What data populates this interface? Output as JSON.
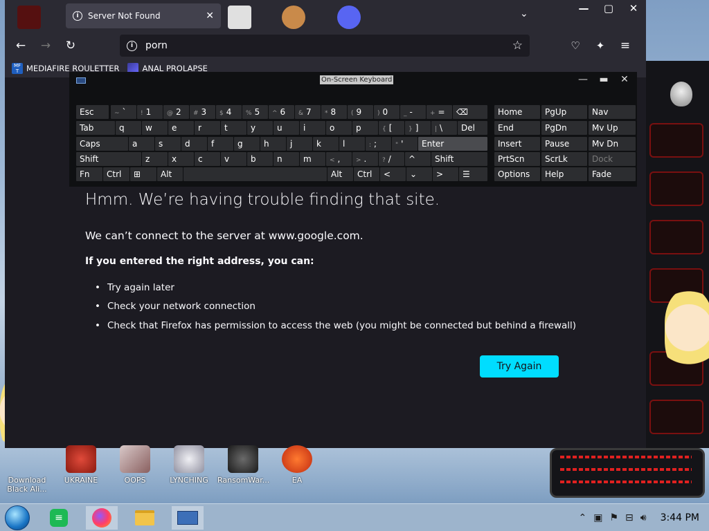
{
  "browser": {
    "tab_title": "Server Not Found",
    "tab_close": "✕",
    "url": "porn",
    "window_controls": [
      "—",
      "▢",
      "✕"
    ]
  },
  "bookmarks": [
    {
      "label": "MEDIAFIRE ROULETTER",
      "icon": "MF\nT"
    },
    {
      "label": "ANAL PROLAPSE",
      "icon": ""
    }
  ],
  "error": {
    "title": "Hmm. We’re having trouble finding that site.",
    "message": "We can’t connect to the server at www.google.com.",
    "subtitle": "If you entered the right address, you can:",
    "items": [
      "Try again later",
      "Check your network connection",
      "Check that Firefox has permission to access the web (you might be connected but behind a firewall)"
    ],
    "button": "Try Again"
  },
  "osk": {
    "title": "On-Screen Keyboard",
    "row1": [
      {
        "l": "Esc"
      },
      {
        "s": "~",
        "l": "`"
      },
      {
        "s": "!",
        "l": "1"
      },
      {
        "s": "@",
        "l": "2"
      },
      {
        "s": "#",
        "l": "3"
      },
      {
        "s": "$",
        "l": "4"
      },
      {
        "s": "%",
        "l": "5"
      },
      {
        "s": "^",
        "l": "6"
      },
      {
        "s": "&",
        "l": "7"
      },
      {
        "s": "*",
        "l": "8"
      },
      {
        "s": "(",
        "l": "9"
      },
      {
        "s": ")",
        "l": "0"
      },
      {
        "s": "_",
        "l": "-"
      },
      {
        "s": "+",
        "l": "="
      },
      {
        "l": "⌫"
      }
    ],
    "row2": [
      {
        "l": "Tab"
      },
      {
        "l": "q"
      },
      {
        "l": "w"
      },
      {
        "l": "e"
      },
      {
        "l": "r"
      },
      {
        "l": "t"
      },
      {
        "l": "y"
      },
      {
        "l": "u"
      },
      {
        "l": "i"
      },
      {
        "l": "o"
      },
      {
        "l": "p"
      },
      {
        "s": "{",
        "l": "["
      },
      {
        "s": "}",
        "l": "]"
      },
      {
        "s": "|",
        "l": "\\"
      },
      {
        "l": "Del"
      }
    ],
    "row3": [
      {
        "l": "Caps"
      },
      {
        "l": "a"
      },
      {
        "l": "s"
      },
      {
        "l": "d"
      },
      {
        "l": "f"
      },
      {
        "l": "g"
      },
      {
        "l": "h"
      },
      {
        "l": "j"
      },
      {
        "l": "k"
      },
      {
        "l": "l"
      },
      {
        "s": ":",
        "l": ";"
      },
      {
        "s": "\"",
        "l": "'"
      },
      {
        "l": "Enter"
      }
    ],
    "row4": [
      {
        "l": "Shift"
      },
      {
        "l": "z"
      },
      {
        "l": "x"
      },
      {
        "l": "c"
      },
      {
        "l": "v"
      },
      {
        "l": "b"
      },
      {
        "l": "n"
      },
      {
        "l": "m"
      },
      {
        "s": "<",
        "l": ","
      },
      {
        "s": ">",
        "l": "."
      },
      {
        "s": "?",
        "l": "/"
      },
      {
        "l": "^"
      },
      {
        "l": "Shift"
      }
    ],
    "row5": [
      {
        "l": "Fn"
      },
      {
        "l": "Ctrl"
      },
      {
        "l": "⊞"
      },
      {
        "l": "Alt"
      },
      {
        "l": ""
      },
      {
        "l": "Alt"
      },
      {
        "l": "Ctrl"
      },
      {
        "l": "<"
      },
      {
        "l": "⌄"
      },
      {
        "l": ">"
      },
      {
        "l": "☰"
      }
    ],
    "nav": [
      [
        "Home",
        "PgUp",
        "Nav"
      ],
      [
        "End",
        "PgDn",
        "Mv Up"
      ],
      [
        "Insert",
        "Pause",
        "Mv Dn"
      ],
      [
        "PrtScn",
        "ScrLk",
        "Dock"
      ],
      [
        "Options",
        "Help",
        "Fade"
      ]
    ]
  },
  "desktop_icons": [
    {
      "label": "Download Black Ali...",
      "color": "#c8d6e6"
    },
    {
      "label": "UKRAINE",
      "color": "#d43a2a"
    },
    {
      "label": "OOPS",
      "color": "#b8a8a8"
    },
    {
      "label": "LYNCHING",
      "color": "#c8c8d0"
    },
    {
      "label": "RansomWar...",
      "color": "#3a3a3a"
    },
    {
      "label": "EA",
      "color": "#e0501a"
    }
  ],
  "taskbar": {
    "apps": [
      "spotify-icon",
      "firefox-icon",
      "file-explorer-icon",
      "osk-icon"
    ],
    "clock": "3:44 PM"
  },
  "colors": {
    "accent": "#00ddff",
    "firefox_bg": "#1c1b22",
    "toolbar": "#2b2a33"
  }
}
